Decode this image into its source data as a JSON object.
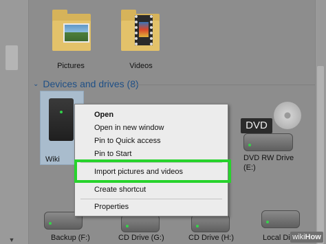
{
  "folders": [
    {
      "label": "Pictures"
    },
    {
      "label": "Videos"
    }
  ],
  "section": {
    "title": "Devices and drives (8)"
  },
  "selected_drive": {
    "label": "Wiki"
  },
  "drives": [
    {
      "label": "DVD RW Drive",
      "sublabel": "(E:)"
    },
    {
      "label": "Backup (F:)"
    },
    {
      "label": "CD Drive (G:)"
    },
    {
      "label": "CD Drive (H:)"
    },
    {
      "label": "Local Disk"
    }
  ],
  "dvd_badge": "DVD",
  "context_menu": {
    "items": [
      {
        "label": "Open"
      },
      {
        "label": "Open in new window"
      },
      {
        "label": "Pin to Quick access"
      },
      {
        "label": "Pin to Start"
      },
      {
        "label": "Import pictures and videos"
      },
      {
        "label": "Create shortcut"
      },
      {
        "label": "Properties"
      }
    ]
  },
  "highlight_color": "#27d32c",
  "watermark": {
    "prefix": "wiki",
    "suffix": "How"
  }
}
